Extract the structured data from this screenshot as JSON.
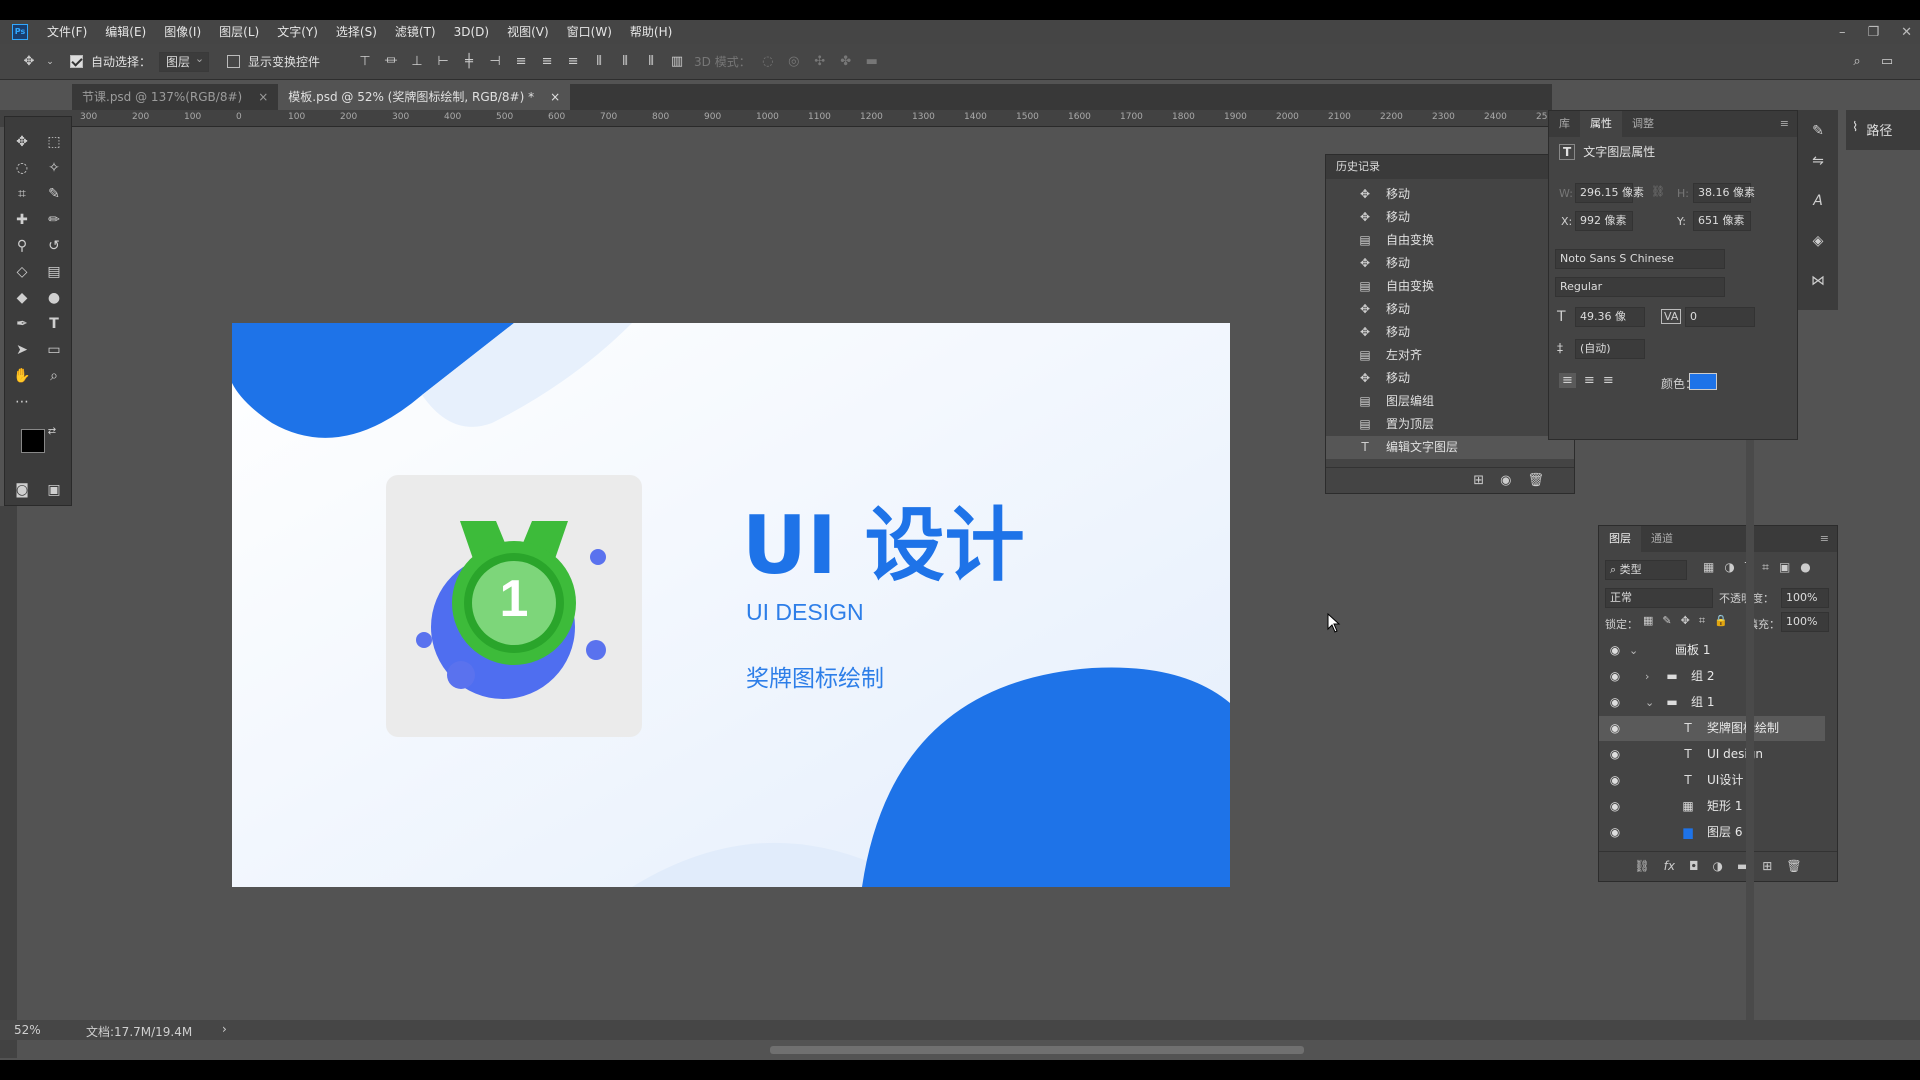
{
  "app": {
    "logo": "Ps"
  },
  "menubar": [
    "文件(F)",
    "编辑(E)",
    "图像(I)",
    "图层(L)",
    "文字(Y)",
    "选择(S)",
    "滤镜(T)",
    "3D(D)",
    "视图(V)",
    "窗口(W)",
    "帮助(H)"
  ],
  "optbar": {
    "auto_select_label": "自动选择：",
    "auto_select_value": "图层",
    "show_transform": "显示变换控件",
    "mode3d": "3D 模式："
  },
  "tabs": [
    {
      "label": "节课.psd @ 137%(RGB/8#)",
      "close": "×"
    },
    {
      "label": "模板.psd @ 52% (奖牌图标绘制, RGB/8#) *",
      "close": "×"
    }
  ],
  "ruler_h": [
    "300",
    "200",
    "100",
    "0",
    "100",
    "200",
    "300",
    "400",
    "500",
    "600",
    "700",
    "800",
    "900",
    "1000",
    "1100",
    "1200",
    "1300",
    "1400",
    "1500",
    "1600",
    "1700",
    "1800",
    "1900",
    "2000",
    "2100",
    "2200",
    "2300",
    "2400",
    "25"
  ],
  "canvas": {
    "title": "UI 设计",
    "subtitle": "UI DESIGN",
    "caption": "奖牌图标绘制",
    "medal_number": "1",
    "colors": {
      "primary": "#1e73e8",
      "medal_green": "#4cc24a",
      "medal_blue": "#4f6ef0"
    }
  },
  "history": {
    "title": "历史记录",
    "items": [
      {
        "icon": "move-icon",
        "label": "移动"
      },
      {
        "icon": "move-icon",
        "label": "移动"
      },
      {
        "icon": "doc-icon",
        "label": "自由变换"
      },
      {
        "icon": "move-icon",
        "label": "移动"
      },
      {
        "icon": "doc-icon",
        "label": "自由变换"
      },
      {
        "icon": "move-icon",
        "label": "移动"
      },
      {
        "icon": "move-icon",
        "label": "移动"
      },
      {
        "icon": "doc-icon",
        "label": "左对齐"
      },
      {
        "icon": "move-icon",
        "label": "移动"
      },
      {
        "icon": "doc-icon",
        "label": "图层编组"
      },
      {
        "icon": "doc-icon",
        "label": "置为顶层"
      },
      {
        "icon": "text-icon",
        "label": "编辑文字图层"
      }
    ]
  },
  "props": {
    "tabs": [
      "库",
      "属性",
      "调整"
    ],
    "header": "文字图层属性",
    "w_label": "W:",
    "w_value": "296.15 像素",
    "h_label": "H:",
    "h_value": "38.16 像素",
    "x_label": "X:",
    "x_value": "992 像素",
    "y_label": "Y:",
    "y_value": "651 像素",
    "font": "Noto Sans S Chinese",
    "style": "Regular",
    "size": "49.36 像",
    "tracking": "0",
    "leading": "(自动)",
    "color_label": "颜色：",
    "color": "#1e73e8"
  },
  "path_panel": {
    "label": "路径"
  },
  "layers": {
    "tabs": [
      "图层",
      "通道"
    ],
    "filter": "类型",
    "blend": "正常",
    "opacity_label": "不透明度：",
    "opacity": "100%",
    "lock_label": "锁定：",
    "fill_label": "填充：",
    "fill": "100%",
    "rows": [
      {
        "name": "画板 1",
        "kind": "artboard"
      },
      {
        "name": "组 2",
        "kind": "group"
      },
      {
        "name": "组 1",
        "kind": "group"
      },
      {
        "name": "奖牌图标绘制",
        "kind": "text"
      },
      {
        "name": "UI design",
        "kind": "text"
      },
      {
        "name": "UI设计",
        "kind": "text"
      },
      {
        "name": "矩形 1",
        "kind": "shape"
      },
      {
        "name": "图层 6",
        "kind": "image"
      }
    ]
  },
  "status": {
    "zoom": "52%",
    "doc": "文档:17.7M/19.4M"
  }
}
